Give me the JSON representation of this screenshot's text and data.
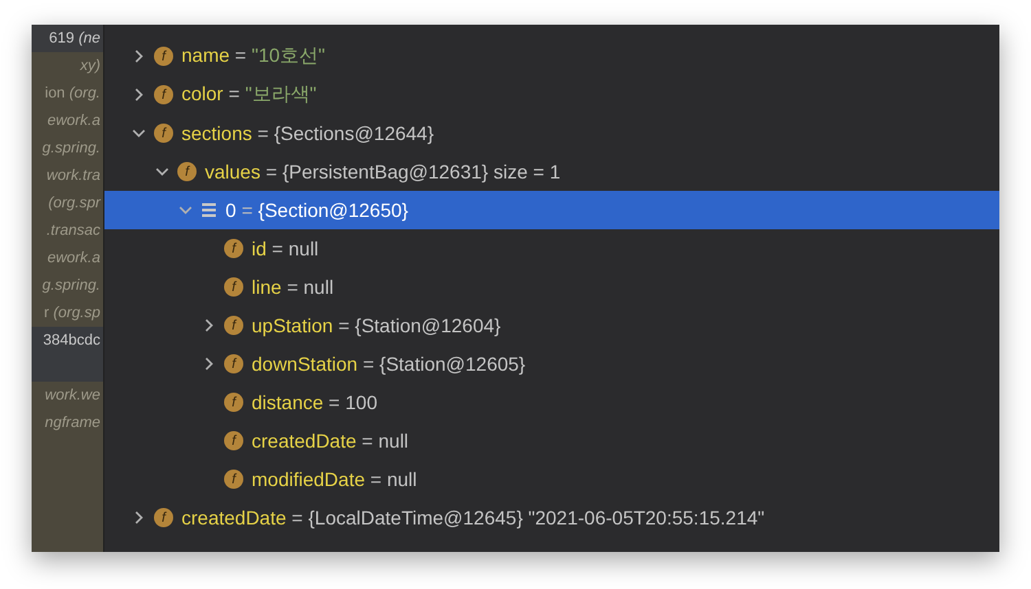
{
  "frames": [
    {
      "text": "619 *(ne*",
      "kind": "current"
    },
    {
      "text": "*xy)*",
      "kind": "library"
    },
    {
      "text": "ion *(org.*",
      "kind": "library"
    },
    {
      "text": "*ework.a*",
      "kind": "library"
    },
    {
      "text": "*g.spring.*",
      "kind": "library"
    },
    {
      "text": "*work.tra*",
      "kind": "library"
    },
    {
      "text": "*(org.spr*",
      "kind": "library"
    },
    {
      "text": "*.transac*",
      "kind": "library"
    },
    {
      "text": "*ework.a*",
      "kind": "library"
    },
    {
      "text": "*g.spring.*",
      "kind": "library"
    },
    {
      "text": "r *(org.sp*",
      "kind": "library"
    },
    {
      "text": "384bcdc",
      "kind": "thread"
    },
    {
      "kind": "gap"
    },
    {
      "text": "*work.we*",
      "kind": "library"
    },
    {
      "text": "*ngframe*",
      "kind": "library"
    }
  ],
  "tree": [
    {
      "badge": "f",
      "name": "name",
      "eq": "=",
      "value": "\"10호선\"",
      "kind": "string",
      "expanded": false,
      "selected": false
    },
    {
      "badge": "f",
      "name": "color",
      "eq": "=",
      "value": "\"보라색\"",
      "kind": "string",
      "expanded": false,
      "selected": false
    },
    {
      "badge": "f",
      "name": "sections",
      "eq": "=",
      "value": "{Sections@12644}",
      "kind": "field",
      "expanded": true,
      "selected": false,
      "children": [
        {
          "badge": "f",
          "name": "values",
          "eq": "=",
          "value": "{PersistentBag@12631}  size = 1",
          "kind": "field",
          "expanded": true,
          "selected": false,
          "children": [
            {
              "name": "0",
              "eq": "=",
              "value": "{Section@12650}",
              "kind": "element",
              "expanded": true,
              "selected": true,
              "children": [
                {
                  "badge": "f",
                  "name": "id",
                  "eq": "=",
                  "value": "null",
                  "kind": "field",
                  "selected": false
                },
                {
                  "badge": "f",
                  "name": "line",
                  "eq": "=",
                  "value": "null",
                  "kind": "field",
                  "selected": false
                },
                {
                  "badge": "f",
                  "name": "upStation",
                  "eq": "=",
                  "value": "{Station@12604}",
                  "kind": "field",
                  "expanded": false,
                  "selected": false
                },
                {
                  "badge": "f",
                  "name": "downStation",
                  "eq": "=",
                  "value": "{Station@12605}",
                  "kind": "field",
                  "expanded": false,
                  "selected": false
                },
                {
                  "badge": "f",
                  "name": "distance",
                  "eq": "=",
                  "value": "100",
                  "kind": "field",
                  "selected": false
                },
                {
                  "badge": "f",
                  "name": "createdDate",
                  "eq": "=",
                  "value": "null",
                  "kind": "field",
                  "selected": false
                },
                {
                  "badge": "f",
                  "name": "modifiedDate",
                  "eq": "=",
                  "value": "null",
                  "kind": "field",
                  "selected": false
                }
              ]
            }
          ]
        }
      ]
    },
    {
      "badge": "f",
      "name": "createdDate",
      "eq": "=",
      "value": "{LocalDateTime@12645} \"2021-06-05T20:55:15.214\"",
      "kind": "field",
      "expanded": false,
      "selected": false
    }
  ]
}
